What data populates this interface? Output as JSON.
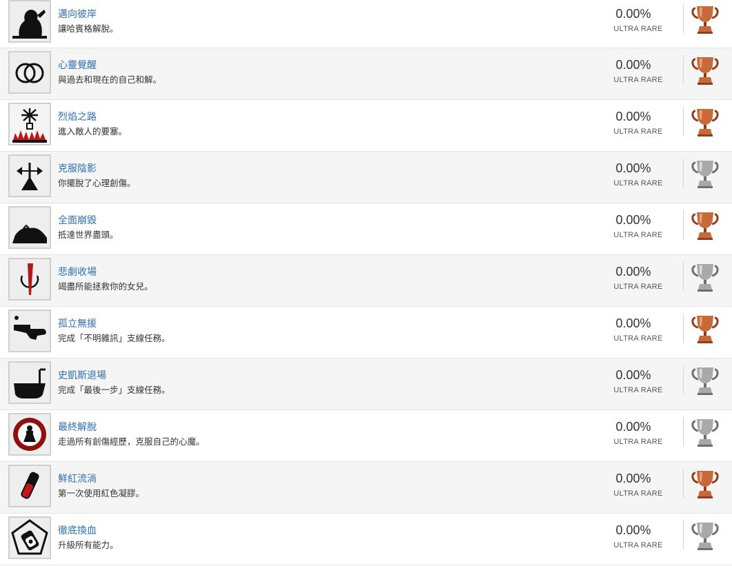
{
  "achievements": [
    {
      "title": "邁向彼岸",
      "desc": "讓哈賓格解脫。",
      "pct": "0.00%",
      "rarity": "ULTRA RARE",
      "trophy": "bronze",
      "icon": "silhouette-icon"
    },
    {
      "title": "心靈覺醒",
      "desc": "與過去和現在的自己和解。",
      "pct": "0.00%",
      "rarity": "ULTRA RARE",
      "trophy": "bronze",
      "icon": "rings-icon"
    },
    {
      "title": "烈焰之路",
      "desc": "進入敵人的要塞。",
      "pct": "0.00%",
      "rarity": "ULTRA RARE",
      "trophy": "bronze",
      "icon": "flame-tree-icon"
    },
    {
      "title": "克服陰影",
      "desc": "你擺脫了心理創傷。",
      "pct": "0.00%",
      "rarity": "ULTRA RARE",
      "trophy": "silver",
      "icon": "wire-pole-icon"
    },
    {
      "title": "全面崩毀",
      "desc": "抵達世界盡頭。",
      "pct": "0.00%",
      "rarity": "ULTRA RARE",
      "trophy": "bronze",
      "icon": "hill-icon"
    },
    {
      "title": "悲劇收場",
      "desc": "竭盡所能拯救你的女兒。",
      "pct": "0.00%",
      "rarity": "ULTRA RARE",
      "trophy": "silver",
      "icon": "blade-icon"
    },
    {
      "title": "孤立無援",
      "desc": "完成「不明雜訊」支線任務。",
      "pct": "0.00%",
      "rarity": "ULTRA RARE",
      "trophy": "bronze",
      "icon": "hand-gun-icon"
    },
    {
      "title": "史凱斯退場",
      "desc": "完成「最後一步」支線任務。",
      "pct": "0.00%",
      "rarity": "ULTRA RARE",
      "trophy": "silver",
      "icon": "bathtub-icon"
    },
    {
      "title": "最終解脫",
      "desc": "走過所有創傷經歷，克服自己的心魔。",
      "pct": "0.00%",
      "rarity": "ULTRA RARE",
      "trophy": "silver",
      "icon": "red-emblem-icon"
    },
    {
      "title": "鮮紅流淌",
      "desc": "第一次使用紅色凝膠。",
      "pct": "0.00%",
      "rarity": "ULTRA RARE",
      "trophy": "bronze",
      "icon": "red-gel-vial-icon"
    },
    {
      "title": "徹底換血",
      "desc": "升級所有能力。",
      "pct": "0.00%",
      "rarity": "ULTRA RARE",
      "trophy": "silver",
      "icon": "pentagon-vial-icon"
    }
  ],
  "colors": {
    "bronze": "#c8693a",
    "silver": "#a9a9a9",
    "title": "#2f6fb3"
  }
}
